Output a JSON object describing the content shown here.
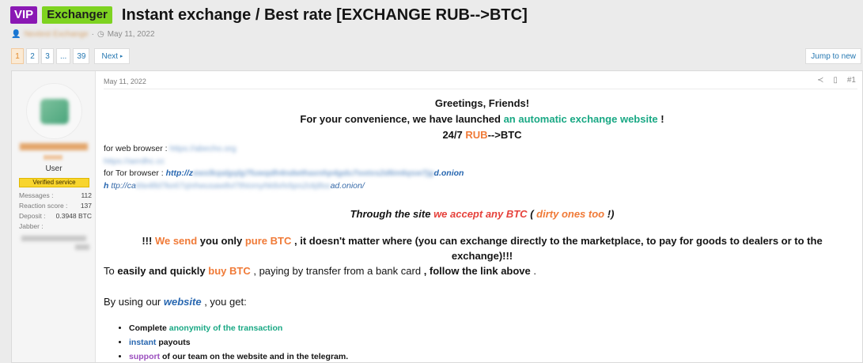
{
  "thread": {
    "prefix_vip": "VIP",
    "prefix_exchanger": "Exchanger",
    "title": "Instant exchange / Best rate [EXCHANGE RUB-->BTC]",
    "author_blurred": "Nextest Exchange",
    "date": "May 11, 2022"
  },
  "pagination": {
    "pages": [
      "1",
      "2",
      "3",
      "...",
      "39"
    ],
    "current": "1",
    "next_label": "Next",
    "jump_label": "Jump to new"
  },
  "user": {
    "role": "User",
    "badge": "Verified service",
    "stats": [
      {
        "key": "Messages :",
        "value": "112"
      },
      {
        "key": "Reaction score :",
        "value": "137"
      },
      {
        "key": "Deposit :",
        "value": "0.3948 BTC"
      },
      {
        "key": "Jabber :",
        "value": ""
      }
    ]
  },
  "post": {
    "date": "May 11, 2022",
    "post_number": "#1",
    "greeting": "Greetings, Friends!",
    "launch_pre": "For your convenience, we have launched",
    "launch_link": "an automatic exchange website",
    "launch_post": "!",
    "h247_pre": "24/7",
    "h247_rub": "RUB",
    "h247_post": "-->BTC",
    "web_label": "for web browser :",
    "web_url_blurred": "https://abecho.org",
    "web_url2_blurred": "https://aerdhc.cc",
    "tor_label": "for Tor browser :",
    "tor_http": "http://z",
    "tor_blurred": "ewxlkqalgqlg7fuwqdh4ndwthaxnhp4gdu7ootxs2d6m6qsw7jg",
    "tor_end": "d.onion",
    "tor2_h": "h",
    "tor2_http": "ttp://ca",
    "tor2_blurred": "klw4lld7ke67zjnhwusaw8vl7thiomyhk8xhrbpo2ckj8ss",
    "tor2_end": "ad.onion/",
    "accept_pre": "Through the site",
    "accept_red": "we accept any BTC",
    "accept_paren_open": "(",
    "accept_dirty": "dirty ones too",
    "accept_paren_close": "!)",
    "send_pre": "!!!",
    "send_we": "We send",
    "send_mid": "you only",
    "send_pure": "pure BTC",
    "send_rest": ", it doesn't matter where (you can exchange directly to the marketplace, to pay for goods to dealers or to the",
    "send_line2": "exchange)!!!",
    "easy_to": "To",
    "easy_bold": "easily and quickly",
    "easy_buy": "buy BTC",
    "easy_mid": ", paying by transfer from a bank card",
    "easy_follow": ", follow the link above",
    "easy_end": ".",
    "using_pre": "By using our",
    "using_link": "website",
    "using_post": ", you get:",
    "bullets": [
      {
        "pre": "Complete",
        "hl": "anonymity of the transaction",
        "post": ""
      },
      {
        "pre": "",
        "hl": "instant",
        "post": "payouts"
      },
      {
        "pre": "",
        "hl": "support",
        "post": "of our team on the website and in the telegram."
      }
    ]
  }
}
